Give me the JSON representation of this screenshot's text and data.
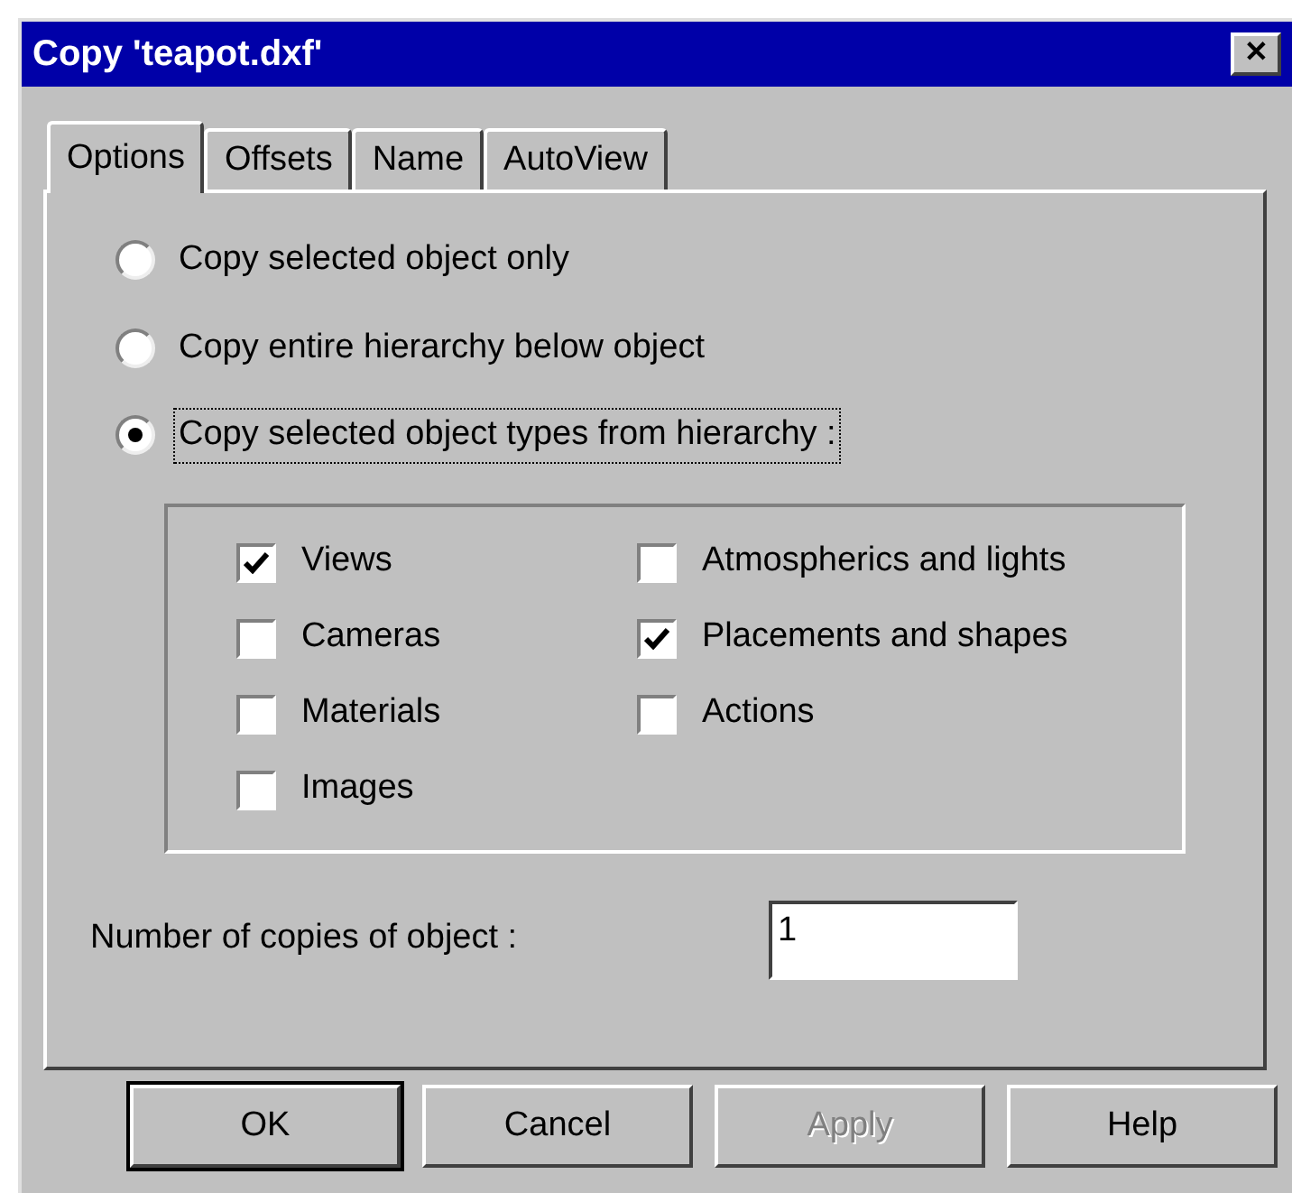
{
  "window": {
    "title": "Copy 'teapot.dxf'",
    "close": "✕"
  },
  "tabs": [
    {
      "label": "Options",
      "selected": true
    },
    {
      "label": "Offsets",
      "selected": false
    },
    {
      "label": "Name",
      "selected": false
    },
    {
      "label": "AutoView",
      "selected": false
    }
  ],
  "radios": [
    {
      "label": "Copy selected object only",
      "selected": false
    },
    {
      "label": "Copy entire hierarchy below object",
      "selected": false
    },
    {
      "label": "Copy selected object types from hierarchy :",
      "selected": true
    }
  ],
  "types": [
    {
      "label": "Views",
      "checked": true
    },
    {
      "label": "Cameras",
      "checked": false
    },
    {
      "label": "Materials",
      "checked": false
    },
    {
      "label": "Images",
      "checked": false
    },
    {
      "label": "Atmospherics and lights",
      "checked": false
    },
    {
      "label": "Placements and shapes",
      "checked": true
    },
    {
      "label": "Actions",
      "checked": false
    }
  ],
  "copies": {
    "label": "Number of copies of object :",
    "value": "1"
  },
  "buttons": [
    {
      "label": "OK",
      "default": true,
      "disabled": false
    },
    {
      "label": "Cancel",
      "default": false,
      "disabled": false
    },
    {
      "label": "Apply",
      "default": false,
      "disabled": true
    },
    {
      "label": "Help",
      "default": false,
      "disabled": false
    }
  ]
}
